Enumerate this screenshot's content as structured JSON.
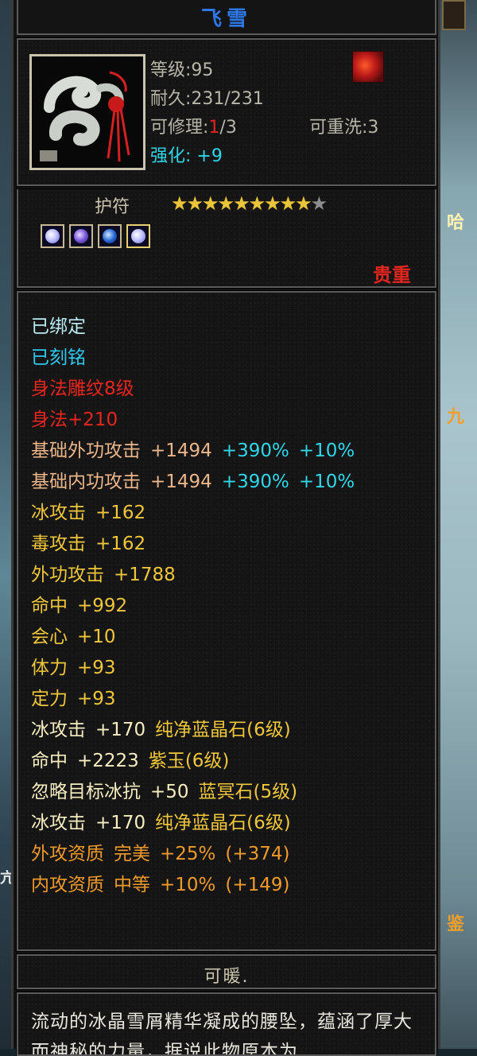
{
  "item": {
    "name": "飞雪",
    "level": "等级:95",
    "durability": "耐久:231/231",
    "repair_prefix": "可修理:",
    "repair_used": "1",
    "repair_max": "/3",
    "rewash": "可重洗:3",
    "enhance": "强化: +9",
    "type_label": "护符",
    "stars_total": 10,
    "stars_filled": 9,
    "rarity": "贵重",
    "gems": [
      "crystal-gem-icon",
      "purple-gem-icon",
      "blue-gem-icon",
      "crystal-gem-icon"
    ]
  },
  "attributes": [
    {
      "parts": [
        {
          "text": "已绑定",
          "color": "#b9e9f2"
        }
      ]
    },
    {
      "parts": [
        {
          "text": "已刻铭",
          "color": "#2fc8f0"
        }
      ]
    },
    {
      "parts": [
        {
          "text": "身法雕纹8级",
          "color": "#e8261e"
        }
      ]
    },
    {
      "parts": [
        {
          "text": "身法+210",
          "color": "#e8261e"
        }
      ]
    },
    {
      "parts": [
        {
          "text": "基础外功攻击",
          "color": "#ecb68a"
        },
        {
          "text": "+1494",
          "color": "#ecb68a"
        },
        {
          "text": "+390%",
          "color": "#2fd7e8"
        },
        {
          "text": "+10%",
          "color": "#2fd7e8"
        }
      ]
    },
    {
      "parts": [
        {
          "text": "基础内功攻击",
          "color": "#ecb68a"
        },
        {
          "text": "+1494",
          "color": "#ecb68a"
        },
        {
          "text": "+390%",
          "color": "#2fd7e8"
        },
        {
          "text": "+10%",
          "color": "#2fd7e8"
        }
      ]
    },
    {
      "parts": [
        {
          "text": "冰攻击",
          "color": "#f0c63a"
        },
        {
          "text": "+162",
          "color": "#f0c63a"
        }
      ]
    },
    {
      "parts": [
        {
          "text": "毒攻击",
          "color": "#f0c63a"
        },
        {
          "text": "+162",
          "color": "#f0c63a"
        }
      ]
    },
    {
      "parts": [
        {
          "text": "外功攻击",
          "color": "#f0c63a"
        },
        {
          "text": "+1788",
          "color": "#f0c63a"
        }
      ]
    },
    {
      "parts": [
        {
          "text": "命中",
          "color": "#f0c63a"
        },
        {
          "text": "+992",
          "color": "#f0c63a"
        }
      ]
    },
    {
      "parts": [
        {
          "text": "会心",
          "color": "#f0c63a"
        },
        {
          "text": "+10",
          "color": "#f0c63a"
        }
      ]
    },
    {
      "parts": [
        {
          "text": "体力",
          "color": "#f0c63a"
        },
        {
          "text": "+93",
          "color": "#f0c63a"
        }
      ]
    },
    {
      "parts": [
        {
          "text": "定力",
          "color": "#f0c63a"
        },
        {
          "text": "+93",
          "color": "#f0c63a"
        }
      ]
    },
    {
      "parts": [
        {
          "text": "冰攻击",
          "color": "#f5edc0"
        },
        {
          "text": "+170",
          "color": "#f5edc0"
        },
        {
          "text": "纯净蓝晶石(6级)",
          "color": "#f0c63a"
        }
      ]
    },
    {
      "parts": [
        {
          "text": "命中",
          "color": "#f5edc0"
        },
        {
          "text": "+2223",
          "color": "#f5edc0"
        },
        {
          "text": "紫玉(6级)",
          "color": "#f0c63a"
        }
      ]
    },
    {
      "parts": [
        {
          "text": "忽略目标冰抗",
          "color": "#f5edc0"
        },
        {
          "text": "+50",
          "color": "#f5edc0"
        },
        {
          "text": "蓝冥石(5级)",
          "color": "#f0c63a"
        }
      ]
    },
    {
      "parts": [
        {
          "text": "冰攻击",
          "color": "#f5edc0"
        },
        {
          "text": "+170",
          "color": "#f5edc0"
        },
        {
          "text": "纯净蓝晶石(6级)",
          "color": "#f0c63a"
        }
      ]
    },
    {
      "parts": [
        {
          "text": "外攻资质",
          "color": "#f09a2a"
        },
        {
          "text": "完美",
          "color": "#f09a2a"
        },
        {
          "text": "+25%",
          "color": "#f09a2a"
        },
        {
          "text": "(+374)",
          "color": "#f09a2a"
        }
      ]
    },
    {
      "parts": [
        {
          "text": "内攻资质",
          "color": "#f09a2a"
        },
        {
          "text": "中等",
          "color": "#f09a2a"
        },
        {
          "text": "+10%",
          "color": "#f09a2a"
        },
        {
          "text": "(+149)",
          "color": "#f09a2a"
        }
      ]
    }
  ],
  "footer": {
    "short_desc": "可暖.",
    "lore": "流动的冰晶雪屑精华凝成的腰坠，蕴涵了厚大而神秘的力量，据说此物原本为"
  },
  "background": {
    "right_fragments": [
      "哈",
      "九",
      "鉴"
    ],
    "left_fragments": [
      "亢"
    ]
  }
}
